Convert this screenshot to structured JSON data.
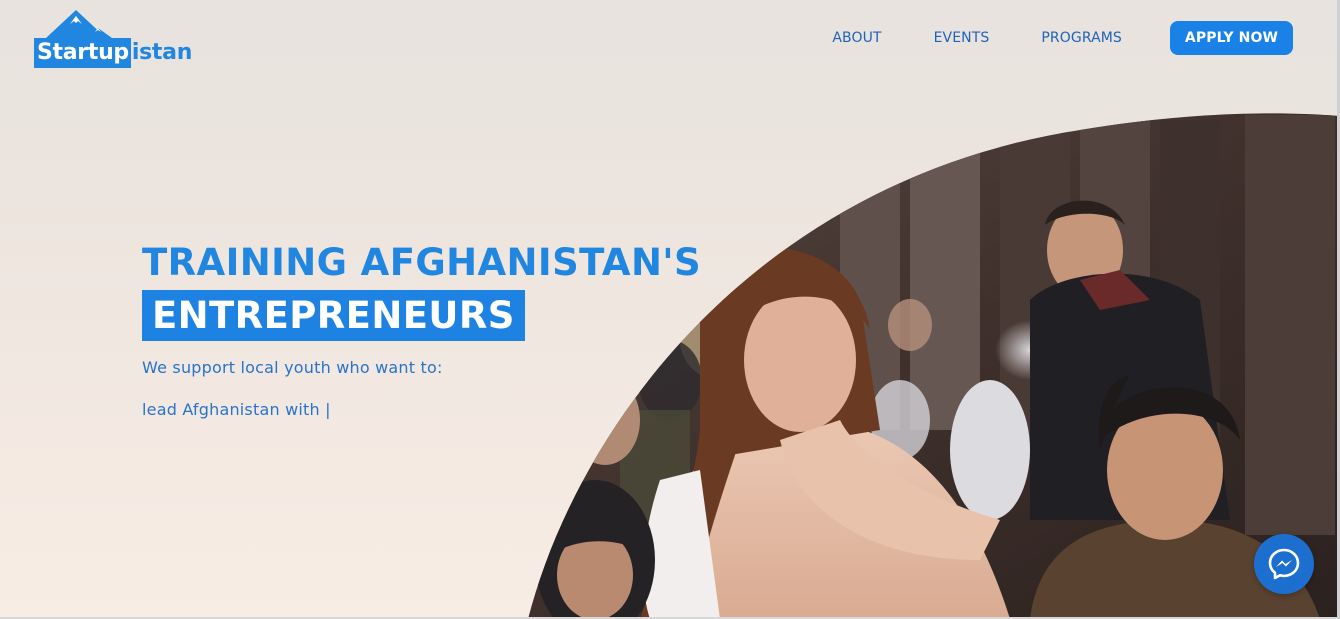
{
  "brand": {
    "logo_box_text": "Startup",
    "logo_rest_text": "istan",
    "accent_color": "#2186e0"
  },
  "nav": {
    "items": [
      {
        "label": "ABOUT"
      },
      {
        "label": "EVENTS"
      },
      {
        "label": "PROGRAMS"
      }
    ],
    "cta_label": "APPLY NOW"
  },
  "hero": {
    "headline": "TRAINING AFGHANISTAN'S",
    "highlight": "ENTREPRENEURS",
    "subtitle": "We support local youth who want to:",
    "typed_text": "lead Afghanistan with |"
  },
  "widgets": {
    "messenger_icon": "messenger-icon"
  }
}
